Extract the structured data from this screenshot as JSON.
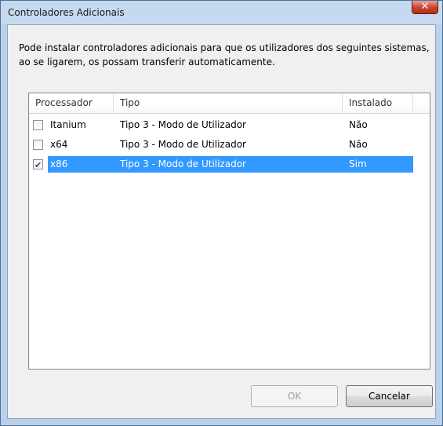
{
  "window": {
    "title": "Controladores Adicionais",
    "close_glyph": "✕"
  },
  "description": "Pode instalar controladores adicionais para que os utilizadores dos seguintes sistemas, ao se ligarem, os possam transferir automaticamente.",
  "list": {
    "columns": [
      "Processador",
      "Tipo",
      "Instalado"
    ],
    "rows": [
      {
        "processor": "Itanium",
        "type": "Tipo 3 - Modo de Utilizador",
        "installed": "Não",
        "checked": false,
        "selected": false
      },
      {
        "processor": "x64",
        "type": "Tipo 3 - Modo de Utilizador",
        "installed": "Não",
        "checked": false,
        "selected": false
      },
      {
        "processor": "x86",
        "type": "Tipo 3 - Modo de Utilizador",
        "installed": "Sim",
        "checked": true,
        "selected": true
      }
    ]
  },
  "buttons": {
    "ok": "OK",
    "ok_disabled": true,
    "cancel": "Cancelar"
  },
  "colors": {
    "selection": "#3399ff",
    "title_bar": "#c5d9ef",
    "close": "#c7412c"
  }
}
